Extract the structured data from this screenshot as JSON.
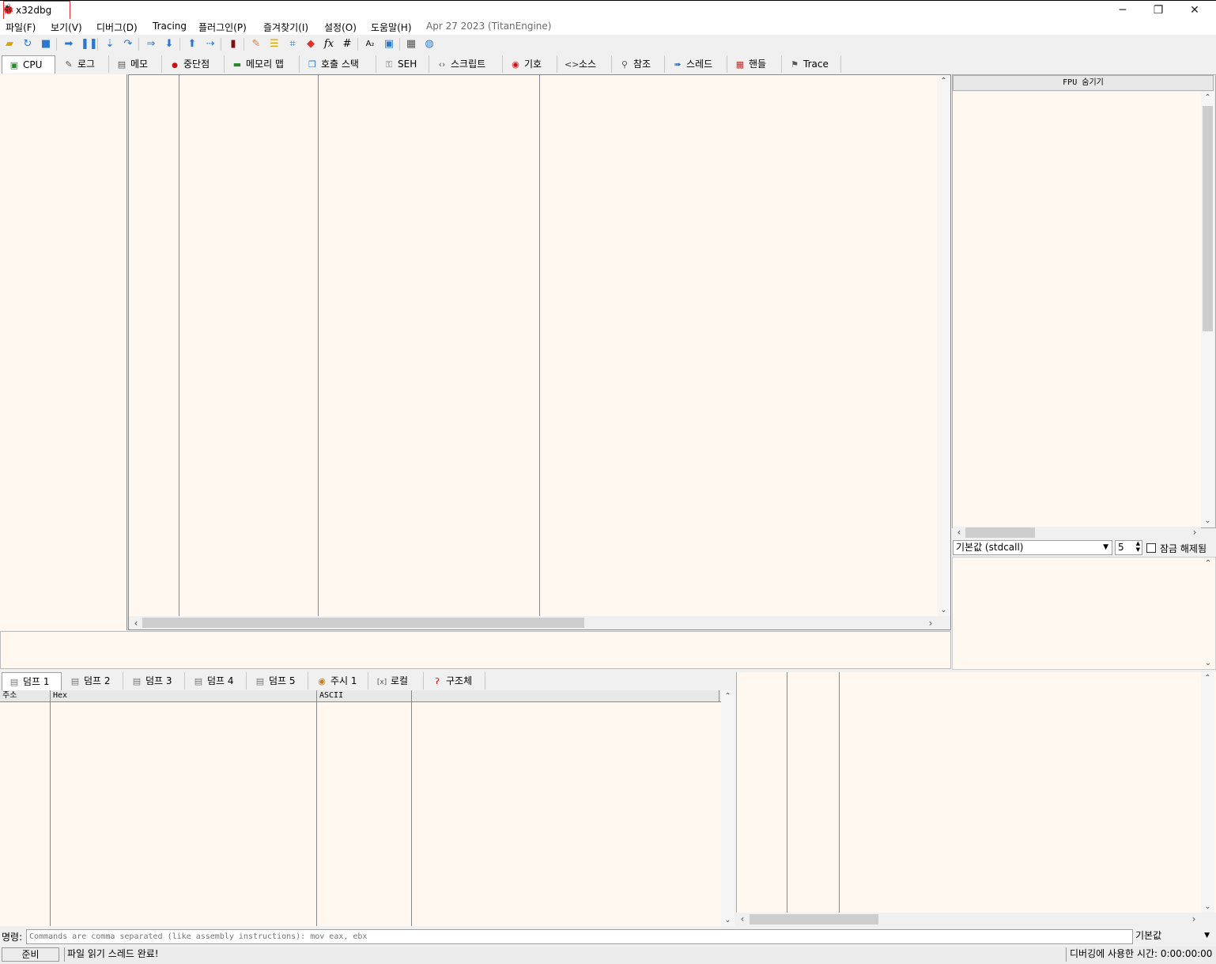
{
  "window": {
    "title": "x32dbg",
    "icon": "bug-icon"
  },
  "window_controls": {
    "minimize": "─",
    "restore": "❐",
    "close": "✕"
  },
  "menu": {
    "items": [
      "파일(F)",
      "보기(V)",
      "디버그(D)",
      "Tracing",
      "플러그인(P)",
      "즐겨찾기(I)",
      "설정(O)",
      "도움말(H)"
    ],
    "info": "Apr 27 2023 (TitanEngine)"
  },
  "toolbar": {
    "icons": [
      "open-icon",
      "restart-icon",
      "stop-icon",
      "run-icon",
      "pause-icon",
      "step-into-icon",
      "step-over-icon",
      "run-to-user-icon",
      "animate-icon",
      "execute-till-return-icon",
      "run-to-cursor-icon",
      "trace-icon",
      "patch-icon",
      "comments-icon",
      "labels-icon",
      "bookmarks-icon",
      "functions-icon",
      "hash-icon",
      "strings-icon",
      "module-icon",
      "calculator-icon",
      "globe-icon"
    ],
    "glyphs": {
      "fx": "fx",
      "hash": "#",
      "strings": "A₂"
    }
  },
  "tabs": [
    {
      "label": "CPU",
      "icon": "cpu-icon",
      "glyph": "▣"
    },
    {
      "label": "로그",
      "icon": "log-icon",
      "glyph": "✎"
    },
    {
      "label": "메모",
      "icon": "notes-icon",
      "glyph": "▤"
    },
    {
      "label": "중단점",
      "icon": "breakpoint-icon",
      "glyph": "●"
    },
    {
      "label": "메모리 맵",
      "icon": "memory-map-icon",
      "glyph": "▬"
    },
    {
      "label": "호출 스택",
      "icon": "call-stack-icon",
      "glyph": "❐"
    },
    {
      "label": "SEH",
      "icon": "seh-icon",
      "glyph": "⚿"
    },
    {
      "label": "스크립트",
      "icon": "script-icon",
      "glyph": "‹›"
    },
    {
      "label": "기호",
      "icon": "symbols-icon",
      "glyph": "◉"
    },
    {
      "label": "소스",
      "icon": "source-icon",
      "glyph": "<>"
    },
    {
      "label": "참조",
      "icon": "references-icon",
      "glyph": "⚲"
    },
    {
      "label": "스레드",
      "icon": "threads-icon",
      "glyph": "➠"
    },
    {
      "label": "핸들",
      "icon": "handles-icon",
      "glyph": "▦"
    },
    {
      "label": "Trace",
      "icon": "trace-icon",
      "glyph": "⚑"
    }
  ],
  "registers": {
    "header": "FPU 숨기기"
  },
  "callconv": {
    "value": "기본값 (stdcall)",
    "arg_count": "5",
    "lock_label": "잠금 해제됨"
  },
  "dump_tabs": [
    {
      "label": "덤프 1",
      "icon": "dump-icon"
    },
    {
      "label": "덤프 2",
      "icon": "dump-icon"
    },
    {
      "label": "덤프 3",
      "icon": "dump-icon"
    },
    {
      "label": "덤프 4",
      "icon": "dump-icon"
    },
    {
      "label": "덤프 5",
      "icon": "dump-icon"
    },
    {
      "label": "주시 1",
      "icon": "watch-icon"
    },
    {
      "label": "로컬",
      "icon": "locals-icon"
    },
    {
      "label": "구조체",
      "icon": "struct-icon"
    }
  ],
  "dump_columns": [
    "주소",
    "Hex",
    "ASCII",
    ""
  ],
  "command": {
    "label": "명령:",
    "placeholder": "Commands are comma separated (like assembly instructions): mov eax, ebx",
    "mode": "기본값"
  },
  "status": {
    "state": "준비",
    "message": "파일 읽기 스레드 완료!",
    "time": "디버깅에 사용한 시간: 0:00:00:00"
  },
  "colors": {
    "pane_bg": "#fff8f0",
    "accent_red": "#e03030"
  }
}
